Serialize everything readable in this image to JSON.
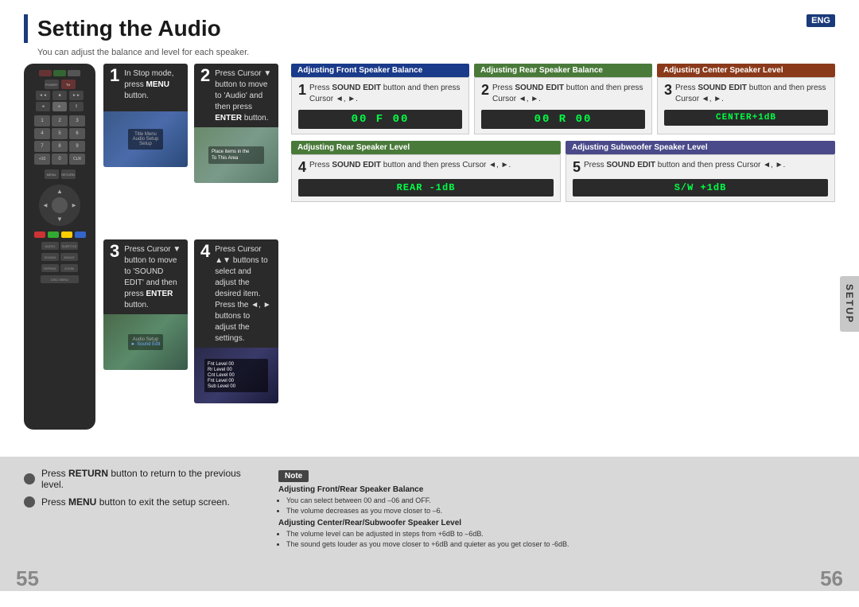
{
  "page": {
    "title": "Setting the Audio",
    "subtitle": "You can adjust the balance and level for each speaker.",
    "eng_badge": "ENG",
    "setup_label": "SETUP",
    "page_left": "55",
    "page_right": "56"
  },
  "instructions": [
    {
      "number": "1",
      "text": "In Stop mode, press MENU button.",
      "image_type": "menu"
    },
    {
      "number": "2",
      "text": "Press Cursor ▼ button to move to 'Audio' and then press ENTER button.",
      "image_type": "landscape"
    },
    {
      "number": "3",
      "text": "Press Cursor ▼ button to move to 'SOUND EDIT' and then press ENTER button.",
      "image_type": "setup"
    },
    {
      "number": "4",
      "text": "Press Cursor ▲▼ buttons to select and adjust the desired item. Press the ◄, ► buttons to adjust the settings.",
      "image_type": "settings"
    }
  ],
  "adjustments": {
    "sections": [
      {
        "id": "front-balance",
        "header": "Adjusting Front Speaker Balance",
        "header_class": "front",
        "step_number": "1",
        "step_bold": "SOUND EDIT",
        "step_text": "Press SOUND EDIT button and then press Cursor ◄, ►.",
        "display": "00 F  00"
      },
      {
        "id": "rear-balance",
        "header": "Adjusting Rear Speaker Balance",
        "header_class": "rear-bal",
        "step_number": "2",
        "step_bold": "SOUND EDIT",
        "step_text": "Press SOUND EDIT button and then press Cursor ◄, ►.",
        "display": "00 R  00"
      },
      {
        "id": "center-level",
        "header": "Adjusting Center Speaker Level",
        "header_class": "center",
        "step_number": "3",
        "step_bold": "SOUND EDIT",
        "step_text": "Press SOUND EDIT button and then press Cursor ◄, ►.",
        "display": "CENTER+1dB"
      },
      {
        "id": "rear-level",
        "header": "Adjusting Rear Speaker Level",
        "header_class": "rear-lev",
        "step_number": "4",
        "step_bold": "SOUND EDIT",
        "step_text": "Press SOUND EDIT button and then press Cursor ◄, ►.",
        "display": "REAR  -1dB"
      },
      {
        "id": "sub-level",
        "header": "Adjusting Subwoofer Speaker Level",
        "header_class": "sub",
        "step_number": "5",
        "step_bold": "SOUND EDIT",
        "step_text": "Press SOUND EDIT button and then press Cursor ◄, ►.",
        "display": "S/W  +1dB"
      }
    ]
  },
  "bottom": {
    "instructions": [
      {
        "text_plain": "Press ",
        "text_bold": "RETURN",
        "text_after": " button to return to the previous level."
      },
      {
        "text_plain": "Press ",
        "text_bold": "MENU",
        "text_after": " button to exit the setup screen."
      }
    ],
    "note_label": "Note",
    "note_sections": [
      {
        "title": "Adjusting Front/Rear Speaker Balance",
        "bullets": [
          "You can select between 00 and –06 and OFF.",
          "The volume decreases as you move closer to –6."
        ]
      },
      {
        "title": "Adjusting Center/Rear/Subwoofer Speaker Level",
        "bullets": [
          "The volume level can be adjusted in steps from +6dB to –6dB.",
          "The sound gets louder as you move closer to +6dB and quieter as you get closer to -6dB."
        ]
      }
    ]
  }
}
